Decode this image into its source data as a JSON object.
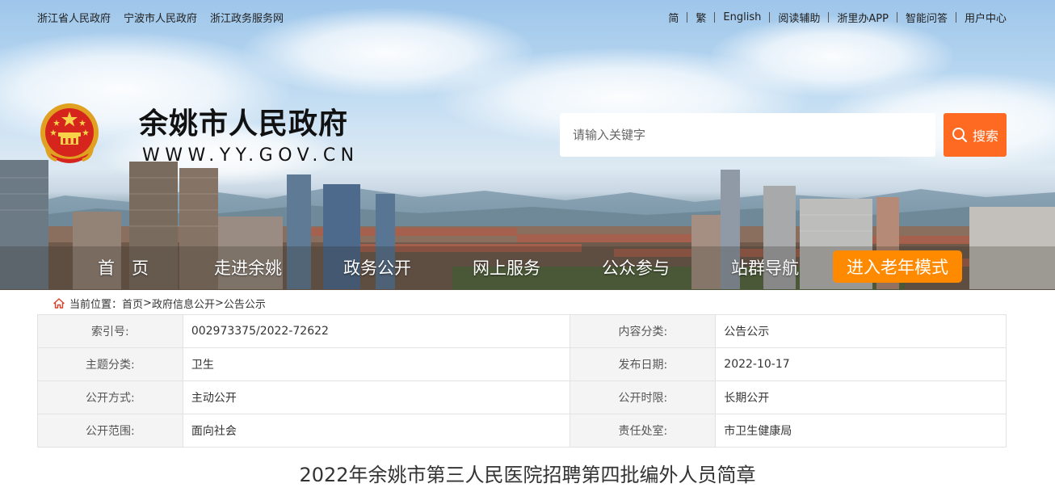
{
  "top_links_left": [
    "浙江省人民政府",
    "宁波市人民政府",
    "浙江政务服务网"
  ],
  "top_links_right": [
    "简",
    "繁",
    "English",
    "阅读辅助",
    "浙里办APP",
    "智能问答",
    "用户中心"
  ],
  "site": {
    "title": "余姚市人民政府",
    "url": "WWW.YY.GOV.CN"
  },
  "search": {
    "placeholder": "请输入关键字",
    "button_label": "搜索"
  },
  "nav": {
    "items": [
      "首　页",
      "走进余姚",
      "政务公开",
      "网上服务",
      "公众参与",
      "站群导航"
    ],
    "elder_mode": "进入老年模式"
  },
  "breadcrumb": {
    "prefix": "当前位置：",
    "items": [
      "首页",
      "政府信息公开",
      "公告公示"
    ],
    "separator": ">"
  },
  "meta": {
    "rows": [
      {
        "k1": "索引号:",
        "v1": "002973375/2022-72622",
        "k2": "内容分类:",
        "v2": "公告公示"
      },
      {
        "k1": "主题分类:",
        "v1": "卫生",
        "k2": "发布日期:",
        "v2": "2022-10-17"
      },
      {
        "k1": "公开方式:",
        "v1": "主动公开",
        "k2": "公开时限:",
        "v2": "长期公开"
      },
      {
        "k1": "公开范围:",
        "v1": "面向社会",
        "k2": "责任处室:",
        "v2": "市卫生健康局"
      }
    ]
  },
  "article": {
    "title": "2022年余姚市第三人民医院招聘第四批编外人员简章"
  },
  "colors": {
    "search_button": "#ff6a22",
    "elder_button": "#ff8a00"
  }
}
